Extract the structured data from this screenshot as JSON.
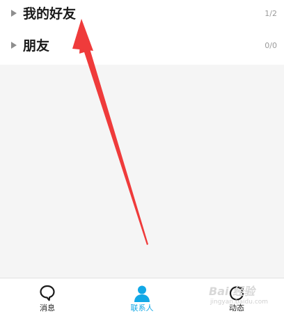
{
  "groups": [
    {
      "name": "我的好友",
      "count": "1/2"
    },
    {
      "name": "朋友",
      "count": "0/0"
    }
  ],
  "tabbar": {
    "tabs": [
      {
        "label": "消息",
        "icon": "message-bubble-icon",
        "active": false
      },
      {
        "label": "联系人",
        "icon": "contacts-person-icon",
        "active": true
      },
      {
        "label": "动态",
        "icon": "refresh-icon",
        "active": false
      }
    ]
  },
  "watermark": {
    "brand": "Bai 经验",
    "sub": "jingyan.baidu.com"
  },
  "colors": {
    "accent": "#12a8e6",
    "annotation_arrow": "#ef3b3b",
    "background": "#f5f5f5"
  }
}
